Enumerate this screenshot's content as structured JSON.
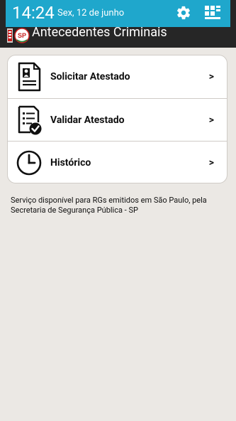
{
  "status_bar": {
    "time": "14:24",
    "date": "Sex, 12 de junho",
    "color": "#1fa7cc"
  },
  "app_bar": {
    "title": "Antecedentes Criminais",
    "logo_text": "SP"
  },
  "menu": {
    "items": [
      {
        "label": "Solicitar Atestado",
        "arrow": ">",
        "icon": "document-person-icon"
      },
      {
        "label": "Validar Atestado",
        "arrow": ">",
        "icon": "checklist-check-icon"
      },
      {
        "label": "Histórico",
        "arrow": ">",
        "icon": "clock-icon"
      }
    ]
  },
  "info": {
    "text": "Serviço disponível para RGs emitidos em São Paulo, pela Secretaria de Segurança Pública - SP"
  }
}
